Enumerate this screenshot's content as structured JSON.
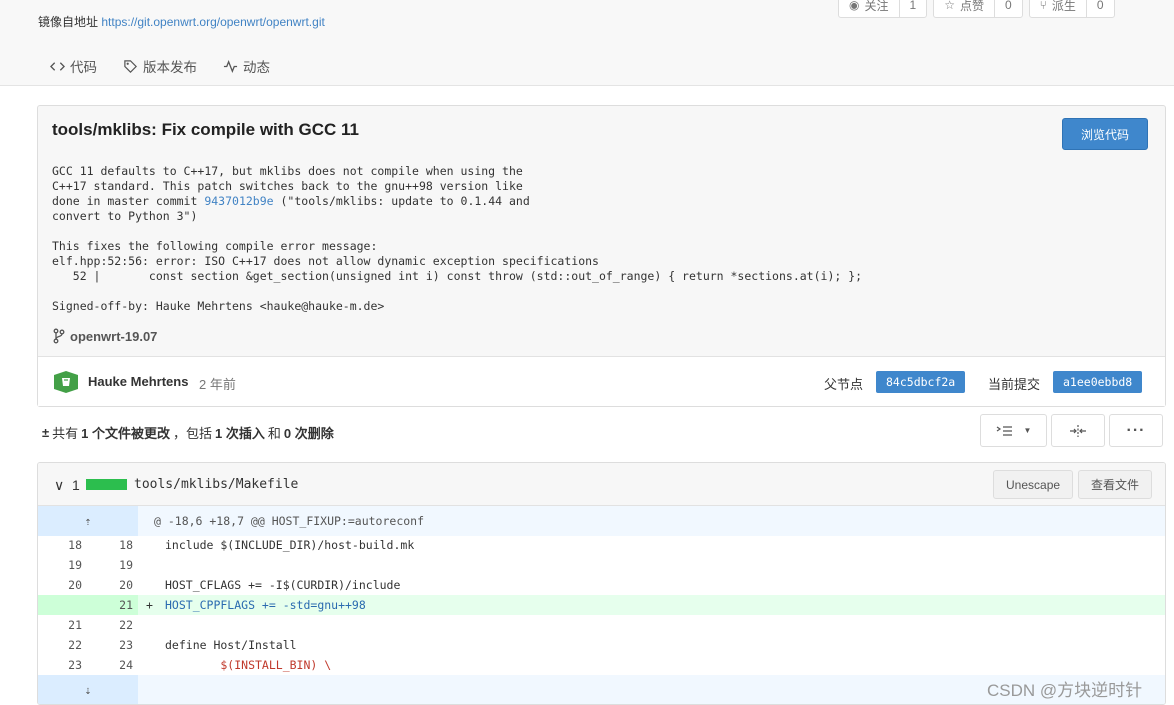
{
  "header": {
    "mirror_label": "镜像自地址",
    "mirror_url": "https://git.openwrt.org/openwrt/openwrt.git",
    "watch_label": "关注",
    "watch_count": "1",
    "star_label": "点赞",
    "star_count": "0",
    "fork_label": "派生",
    "fork_count": "0",
    "tabs": [
      {
        "label": "代码",
        "icon": "code-icon"
      },
      {
        "label": "版本发布",
        "icon": "tag-icon"
      },
      {
        "label": "动态",
        "icon": "activity-icon"
      }
    ]
  },
  "commit": {
    "title": "tools/mklibs: Fix compile with GCC 11",
    "browse_button": "浏览代码",
    "message_lines": [
      "GCC 11 defaults to C++17, but mklibs does not compile when using the",
      "C++17 standard. This patch switches back to the gnu++98 version like",
      "done in master commit ",
      "convert to Python 3\")",
      "",
      "This fixes the following compile error message:",
      "elf.hpp:52:56: error: ISO C++17 does not allow dynamic exception specifications",
      "   52 |       const section &get_section(unsigned int i) const throw (std::out_of_range) { return *sections.at(i); };",
      "",
      "Signed-off-by: Hauke Mehrtens <hauke@hauke-m.de>"
    ],
    "linked_commit": "9437012b9e",
    "linked_commit_suffix": " (\"tools/mklibs: update to 0.1.44 and",
    "branch": "openwrt-19.07",
    "author": "Hauke Mehrtens",
    "time": "2 年前",
    "parent_label": "父节点",
    "parent_sha": "84c5dbcf2a",
    "current_label": "当前提交",
    "current_sha": "a1ee0ebbd8"
  },
  "summary": {
    "prefix": "共有",
    "files": "1 个文件被更改",
    "sep": "，包括",
    "insertions": "1 次插入",
    "and": "和",
    "deletions": "0 次删除"
  },
  "file": {
    "count": "1",
    "path": "tools/mklibs/Makefile",
    "unescape_button": "Unescape",
    "view_button": "查看文件",
    "hunk": "@ -18,6 +18,7 @@ HOST_FIXUP:=autoreconf",
    "lines": [
      {
        "old": "18",
        "new": "18",
        "mark": "",
        "code": "include $(INCLUDE_DIR)/host-build.mk"
      },
      {
        "old": "19",
        "new": "19",
        "mark": "",
        "code": ""
      },
      {
        "old": "20",
        "new": "20",
        "mark": "",
        "code": "HOST_CFLAGS += -I$(CURDIR)/include"
      },
      {
        "old": "",
        "new": "21",
        "mark": "+",
        "code": "HOST_CPPFLAGS += -std=gnu++98"
      },
      {
        "old": "21",
        "new": "22",
        "mark": "",
        "code": ""
      },
      {
        "old": "22",
        "new": "23",
        "mark": "",
        "code": "define Host/Install"
      },
      {
        "old": "23",
        "new": "24",
        "mark": "",
        "code": "        $(INSTALL_BIN) \\"
      }
    ]
  },
  "watermark": "CSDN @方块逆时针"
}
